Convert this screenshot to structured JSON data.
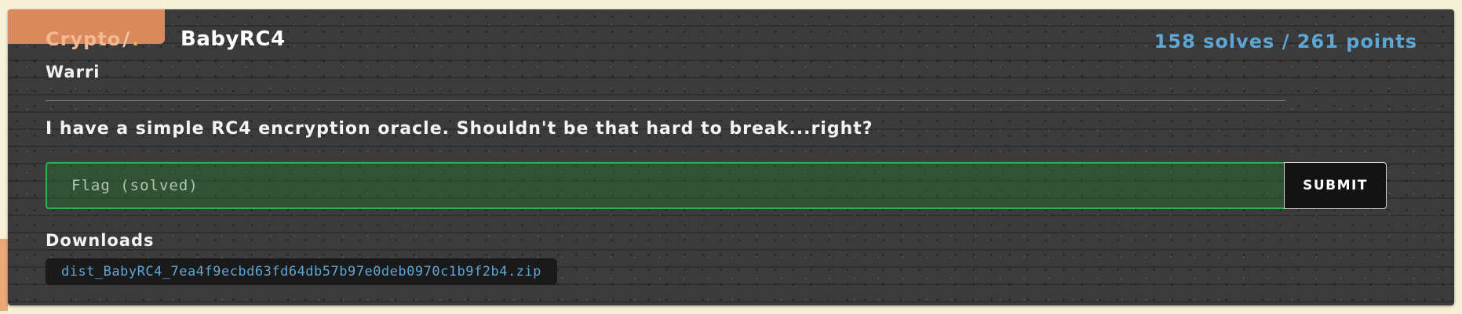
{
  "challenge": {
    "category": "Crypto",
    "category_slash": "/",
    "category_dot": ".",
    "title": "BabyRC4",
    "stats": "158 solves / 261 points",
    "author": "Warri",
    "description": "I have a simple RC4 encryption oracle. Shouldn't be that hard to break...right?"
  },
  "flag_form": {
    "placeholder": "Flag (solved)",
    "value": "",
    "submit_label": "SUBMIT"
  },
  "downloads": {
    "label": "Downloads",
    "files": [
      "dist_BabyRC4_7ea4f9ecbd63fd64db57b97e0deb0970c1b9f2b4.zip"
    ]
  },
  "colors": {
    "page_background": "#f6f0d6",
    "card_background": "#3b3b3b",
    "category_accent": "#d9895c",
    "stats_blue": "#5da6d6",
    "solved_green": "#2db54a"
  }
}
